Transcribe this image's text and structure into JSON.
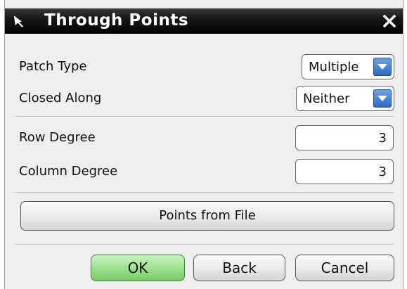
{
  "dialog": {
    "title": "Through Points",
    "title_icon": "pointer-arrow-icon",
    "close_icon": "close-icon"
  },
  "fields": {
    "patch_type": {
      "label": "Patch Type",
      "value": "Multiple"
    },
    "closed_along": {
      "label": "Closed Along",
      "value": "Neither"
    },
    "row_degree": {
      "label": "Row Degree",
      "value": "3"
    },
    "column_degree": {
      "label": "Column Degree",
      "value": "3"
    }
  },
  "buttons": {
    "points_from_file": "Points from File",
    "ok": "OK",
    "back": "Back",
    "cancel": "Cancel"
  },
  "colors": {
    "titlebar": "#000000",
    "dropdown_arrow": "#2d67c2",
    "ok_button": "#9fe18f",
    "dialog_bg": "#eeeeee"
  }
}
